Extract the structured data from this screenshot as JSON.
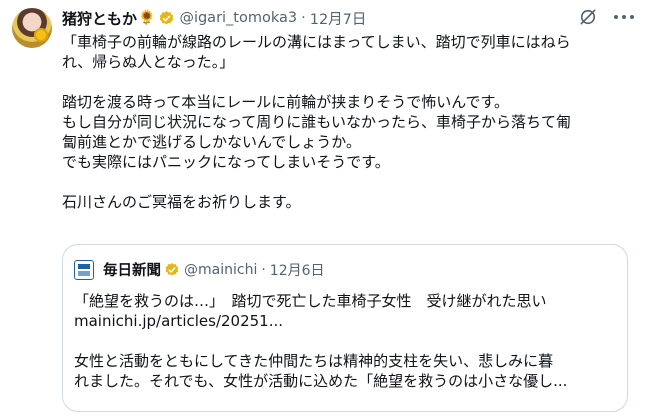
{
  "tweet": {
    "author_name": "猪狩ともか",
    "author_emoji": "🌻",
    "handle": "@igari_tomoka3",
    "separator": "·",
    "date": "12月7日",
    "icons": [
      "avatar",
      "verified-badge-icon",
      "grok-icon",
      "more-icon"
    ],
    "text": {
      "p1_line1": "「車椅子の前輪が線路のレールの溝にはまってしまい、踏切で列車にはねら",
      "p1_line2": "れ、帰らぬ人となった。」",
      "p2_line1": "踏切を渡る時って本当にレールに前輪が挟まりそうで怖いんです。",
      "p2_line2": "もし自分が同じ状況になって周りに誰もいなかったら、車椅子から落ちて匍",
      "p2_line3": "匐前進とかで逃げるしかないんでしょうか。",
      "p2_line4": "でも実際にはパニックになってしまいそうです。",
      "p3_line1": "石川さんのご冥福をお祈りします。"
    }
  },
  "quote": {
    "author_name": "毎日新聞",
    "handle": "@mainichi",
    "separator": "·",
    "date": "12月6日",
    "line1": "「絶望を救うのは…」　踏切で死亡した車椅子女性　受け継がれた思い",
    "line2": "mainichi.jp/articles/20251...",
    "line3": "女性と活動をともにしてきた仲間たちは精神的支柱を失い、悲しみに暮",
    "line4": "れました。それでも、女性が活動に込めた「絶望を救うのは小さな優し..."
  },
  "colors": {
    "verified_gold": "#e2b719",
    "verified_blue": "#1d9bf0",
    "muted_text": "#536471",
    "border": "#cfd9de"
  }
}
